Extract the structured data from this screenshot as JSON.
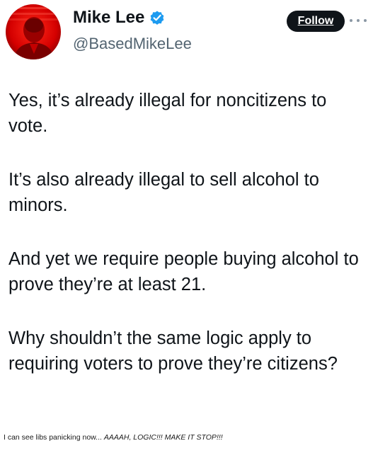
{
  "author": {
    "display_name": "Mike Lee",
    "handle": "@BasedMikeLee",
    "avatar_icon": "profile-avatar",
    "verified_icon": "verified-badge-icon",
    "verified_color": "#1d9bf0",
    "avatar_color": "#e00000"
  },
  "actions": {
    "follow_label": "Follow",
    "more_icon": "more-dots-icon"
  },
  "tweet": {
    "paragraphs": [
      "Yes, it’s already illegal for noncitizens to vote.",
      "It’s also already illegal to sell alcohol to minors.",
      "And yet we require people buying alcohol to prove they’re at least 21.",
      "Why shouldn’t the same logic apply to requiring voters to prove they’re citizens?"
    ]
  },
  "caption": {
    "lead": "I can see libs panicking now... ",
    "emphasis": "AAAAH, LOGIC!!! MAKE IT STOP!!!"
  }
}
